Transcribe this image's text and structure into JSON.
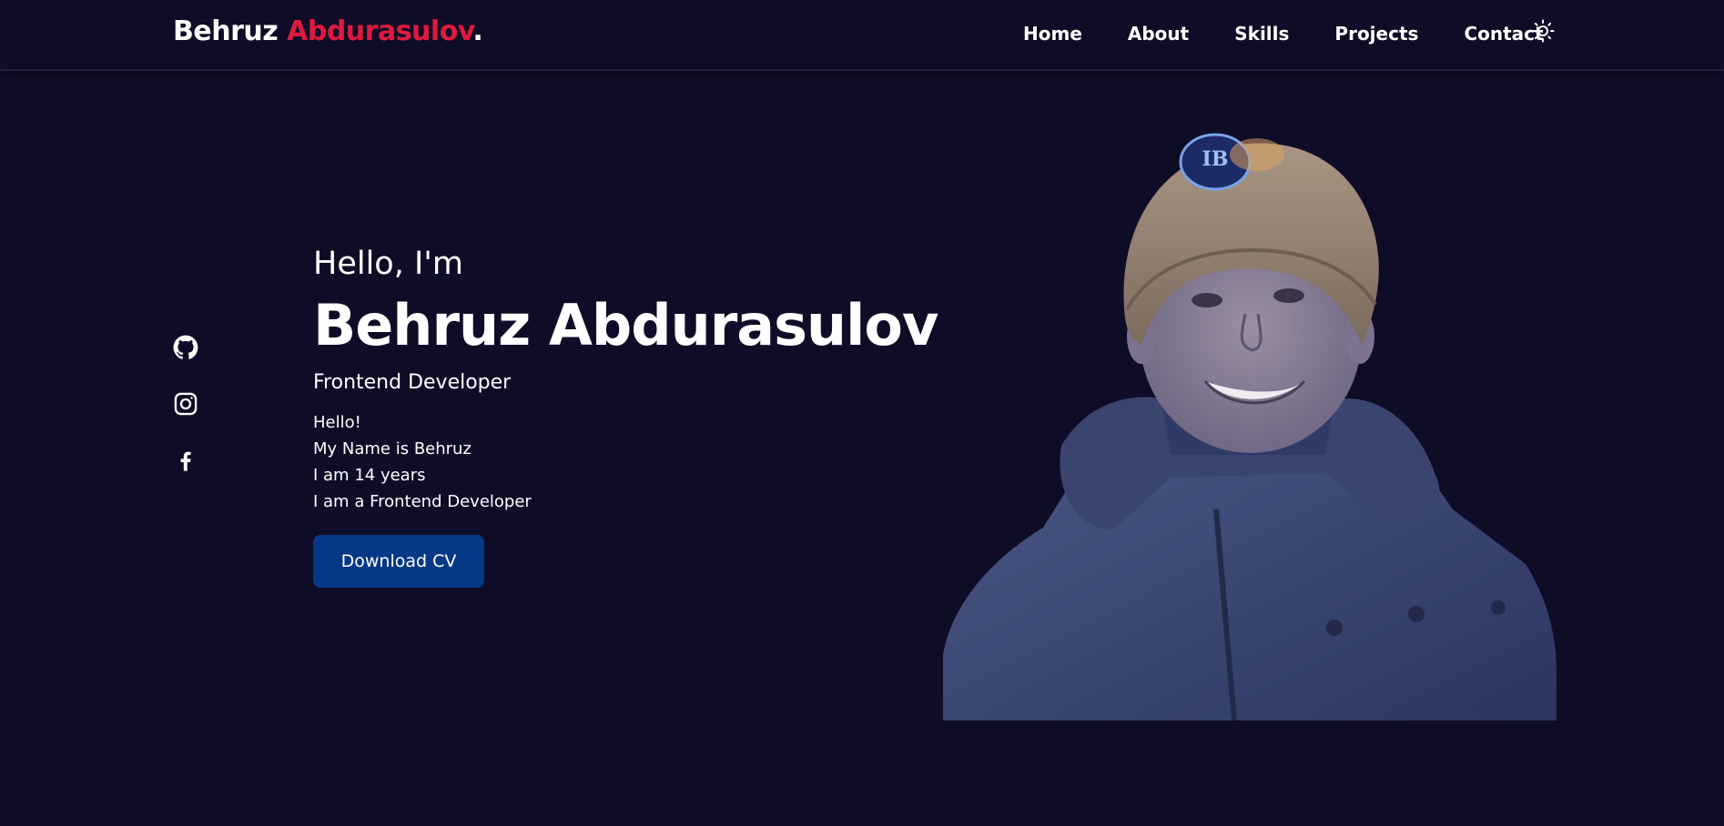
{
  "logo": {
    "first": "Behruz ",
    "accent": "Abdurasulov",
    "dot": ".",
    "accent_color": "#e0193f"
  },
  "nav": {
    "items": [
      {
        "label": "Home"
      },
      {
        "label": "About"
      },
      {
        "label": "Skills"
      },
      {
        "label": "Projects"
      },
      {
        "label": "Contact"
      }
    ],
    "theme_icon": "sun-icon"
  },
  "socials": [
    "github-icon",
    "instagram-icon",
    "facebook-icon"
  ],
  "hero": {
    "greeting": "Hello, I'm",
    "name": "Behruz Abdurasulov",
    "role": "Frontend Developer",
    "bio": [
      "Hello!",
      "My Name is Behruz",
      "I am 14 years",
      "I am a Frontend Developer"
    ],
    "cta_label": "Download CV"
  },
  "colors": {
    "background": "#0f0c27",
    "button": "#063888",
    "text": "#ffffff"
  }
}
